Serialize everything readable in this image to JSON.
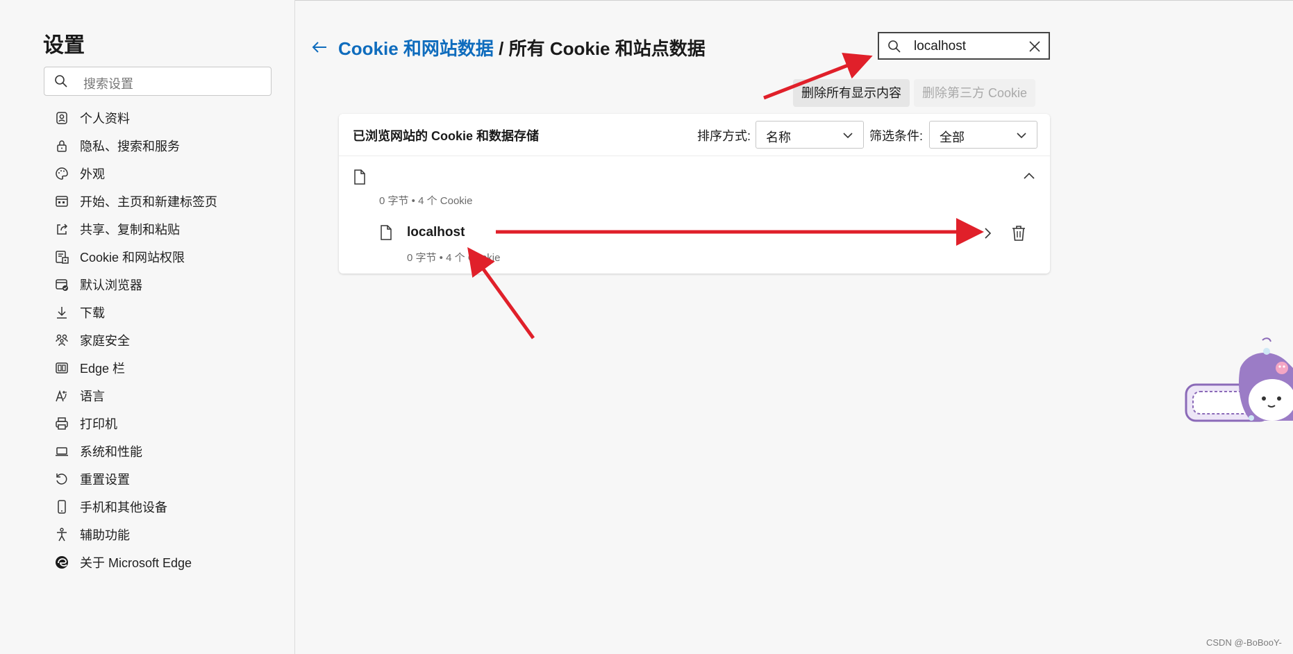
{
  "sidebar": {
    "title": "设置",
    "search_placeholder": "搜索设置",
    "items": [
      {
        "label": "个人资料",
        "icon": "profile-icon"
      },
      {
        "label": "隐私、搜索和服务",
        "icon": "lock-icon"
      },
      {
        "label": "外观",
        "icon": "palette-icon"
      },
      {
        "label": "开始、主页和新建标签页",
        "icon": "start-page-icon"
      },
      {
        "label": "共享、复制和粘贴",
        "icon": "share-icon"
      },
      {
        "label": "Cookie 和网站权限",
        "icon": "cookie-permissions-icon"
      },
      {
        "label": "默认浏览器",
        "icon": "default-browser-icon"
      },
      {
        "label": "下载",
        "icon": "download-icon"
      },
      {
        "label": "家庭安全",
        "icon": "family-icon"
      },
      {
        "label": "Edge 栏",
        "icon": "edge-bar-icon"
      },
      {
        "label": "语言",
        "icon": "language-icon"
      },
      {
        "label": "打印机",
        "icon": "printer-icon"
      },
      {
        "label": "系统和性能",
        "icon": "laptop-icon"
      },
      {
        "label": "重置设置",
        "icon": "reset-icon"
      },
      {
        "label": "手机和其他设备",
        "icon": "phone-icon"
      },
      {
        "label": "辅助功能",
        "icon": "accessibility-icon"
      },
      {
        "label": "关于 Microsoft Edge",
        "icon": "edge-logo-icon"
      }
    ]
  },
  "header": {
    "breadcrumb_link": "Cookie 和网站数据",
    "breadcrumb_sep": " / ",
    "breadcrumb_current": "所有 Cookie 和站点数据"
  },
  "search": {
    "value": "localhost"
  },
  "actions": {
    "delete_all_label": "删除所有显示内容",
    "delete_third_party_label": "删除第三方 Cookie"
  },
  "card": {
    "title": "已浏览网站的 Cookie 和数据存储",
    "sort_label": "排序方式:",
    "sort_value": "名称",
    "filter_label": "筛选条件:",
    "filter_value": "全部",
    "group": {
      "meta": "0 字节 • 4 个 Cookie"
    },
    "site": {
      "name": "localhost",
      "meta": "0 字节 • 4 个 Cookie"
    }
  },
  "colors": {
    "link": "#0f6cbd",
    "annotation_arrow": "#e0202a",
    "sticker_purple": "#8b6ab8"
  },
  "watermark": "CSDN @-BoBooY-"
}
